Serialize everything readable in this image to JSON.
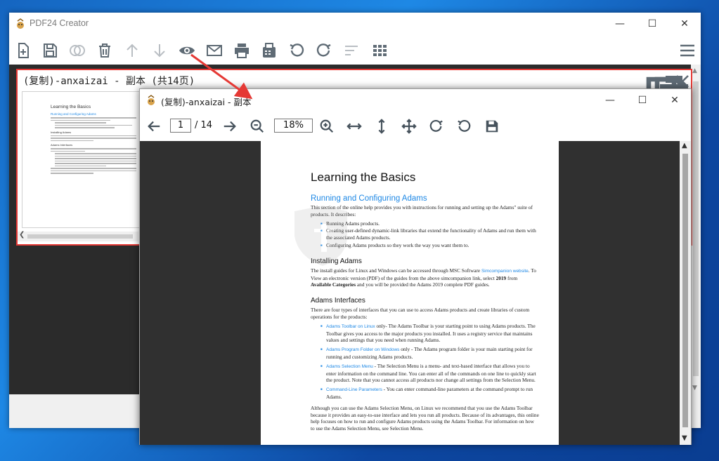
{
  "main_window": {
    "title": "PDF24 Creator",
    "toolbar_icons": [
      "add-file-icon",
      "save-icon",
      "merge-icon",
      "delete-icon",
      "move-up-icon",
      "move-down-icon",
      "preview-eye-icon",
      "email-icon",
      "print-icon",
      "fax-icon",
      "rotate-left-icon",
      "rotate-right-icon",
      "sort-icon",
      "grid-view-icon",
      "menu-icon"
    ]
  },
  "document": {
    "title": "(复制)-anxaizai - 副本 (共14页)",
    "thumbnail": {
      "heading": "Learning the Basics",
      "subheading": "Running and Configuring Adams",
      "section1": "Installing Adams",
      "section2": "Adams Interfaces"
    }
  },
  "viewer": {
    "title": "(复制)-anxaizai - 副本",
    "current_page": "1",
    "total_pages": "/ 14",
    "zoom": "18%"
  },
  "page": {
    "title": "Learning the Basics",
    "section1_title": "Running and Configuring Adams",
    "section1_intro": "This section of the online help provides you with instructions for running and setting up the Adams\" suite of products. It describes:",
    "section1_bullets": [
      "Running Adams products.",
      "Creating user-defined dynamic-link libraries that extend the functionality of Adams and run them with the associated Adams products.",
      "Configuring Adams products so they work the way you want them to."
    ],
    "section2_title": "Installing Adams",
    "section2_text_a": "The install guides for Linux and Windows can be accessed through MSC Software ",
    "section2_link": "Simcompanion website",
    "section2_text_b": ". To View an electronic version (PDF) of the guides from the above simcompanion link, select ",
    "section2_bold1": "2019",
    "section2_text_c": " from ",
    "section2_bold2": "Available Categories",
    "section2_text_d": " and you will be provided the Adams 2019 complete PDF guides.",
    "section3_title": "Adams Interfaces",
    "section3_intro": "There are four types of interfaces that you can use to access Adams products and create libraries of custom operations for the products:",
    "section3_bullets": [
      {
        "link": "Adams Toolbar on Linux",
        "text": " only- The Adams Toolbar is your starting point to using Adams products. The Toolbar gives you access to the major products you installed. It uses a registry service that maintains values and settings that you need when running Adams."
      },
      {
        "link": "Adams Program Folder on Windows",
        "text": " only - The Adams program folder is your main starting point for running and customizing Adams products."
      },
      {
        "link": "Adams Selection Menu",
        "text": " - The Selection Menu is a menu- and text-based interface that allows you to enter information on the command line. You can enter all of the commands on one line to quickly start the product. Note that you cannot access all products nor change all settings from the Selection Menu."
      },
      {
        "link": "Command-Line Parameters",
        "text": " - You can enter command-line parameters at the command prompt to run Adams."
      }
    ],
    "closing": "Although you can use the Adams Selection Menu, on Linux we recommend that you use the Adams Toolbar because it provides an easy-to-use interface and lets you run all products. Because of its advantages, this online help focuses on how to run and configure Adams products using the Adams Toolbar. For information on how to use the Adams Selection Menu, see Selection Menu."
  },
  "colors": {
    "accent": "#1e88e5",
    "highlight_border": "#e53935",
    "arrow": "#e53935",
    "icon_gray": "#5f6b75"
  }
}
